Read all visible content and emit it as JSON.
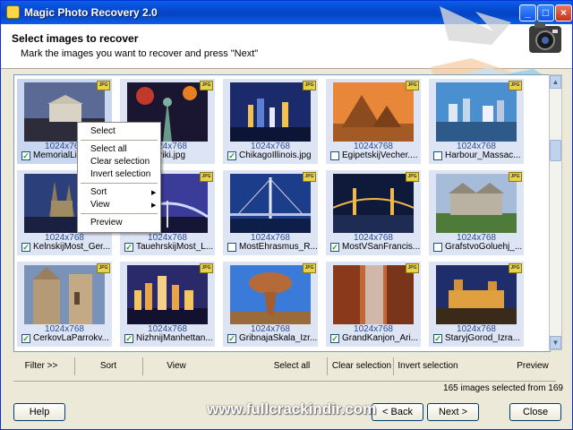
{
  "window": {
    "title": "Magic Photo Recovery 2.0"
  },
  "header": {
    "title": "Select images to recover",
    "subtitle": "Mark the images you want to recover and press \"Next\""
  },
  "context_menu": {
    "items": [
      "Select",
      "Select all",
      "Clear selection",
      "Invert selection",
      "Sort",
      "View",
      "Preview"
    ]
  },
  "gallery": {
    "badge": "JPG",
    "tiles": [
      {
        "name": "MemorialLinko...",
        "res": "1024x768",
        "checked": true
      },
      {
        "name": "aAmeriki.jpg",
        "res": "1024x768",
        "checked": true
      },
      {
        "name": "ChikagoIllinois.jpg",
        "res": "1024x768",
        "checked": true
      },
      {
        "name": "EgipetskijVecher....",
        "res": "1024x768",
        "checked": false
      },
      {
        "name": "Harbour_Massac...",
        "res": "1024x768",
        "checked": false
      },
      {
        "name": "KelnskijMost_Ger...",
        "res": "1024x768",
        "checked": true
      },
      {
        "name": "TauehrskijMost_L...",
        "res": "1024x768",
        "checked": true
      },
      {
        "name": "MostEhrasmus_R...",
        "res": "1024x768",
        "checked": false
      },
      {
        "name": "MostVSanFrancis...",
        "res": "1024x768",
        "checked": true
      },
      {
        "name": "GrafstvoGoluehj_...",
        "res": "1024x768",
        "checked": false
      },
      {
        "name": "CerkovLaParrokv...",
        "res": "1024x768",
        "checked": true
      },
      {
        "name": "NizhnijManhettan...",
        "res": "1024x768",
        "checked": true
      },
      {
        "name": "GribnajaSkala_Izr...",
        "res": "1024x768",
        "checked": true
      },
      {
        "name": "GrandKanjon_Ari...",
        "res": "1024x768",
        "checked": true
      },
      {
        "name": "StaryjGorod_Izra...",
        "res": "1024x768",
        "checked": true
      }
    ]
  },
  "toolbar": {
    "filter": "Filter >>",
    "sort": "Sort",
    "view": "View",
    "select_all": "Select all",
    "clear_selection": "Clear selection",
    "invert_selection": "Invert selection",
    "preview": "Preview"
  },
  "status": {
    "text": "165 images selected from 169"
  },
  "buttons": {
    "help": "Help",
    "back": "< Back",
    "next": "Next >",
    "close": "Close"
  },
  "watermark": "www.fullcrackindir.com",
  "colors": {
    "titlebar": "#0a5fe6",
    "window_bg": "#ece9d8",
    "tile_bg": "#dde5f5",
    "resolution_text": "#2a4a95"
  }
}
